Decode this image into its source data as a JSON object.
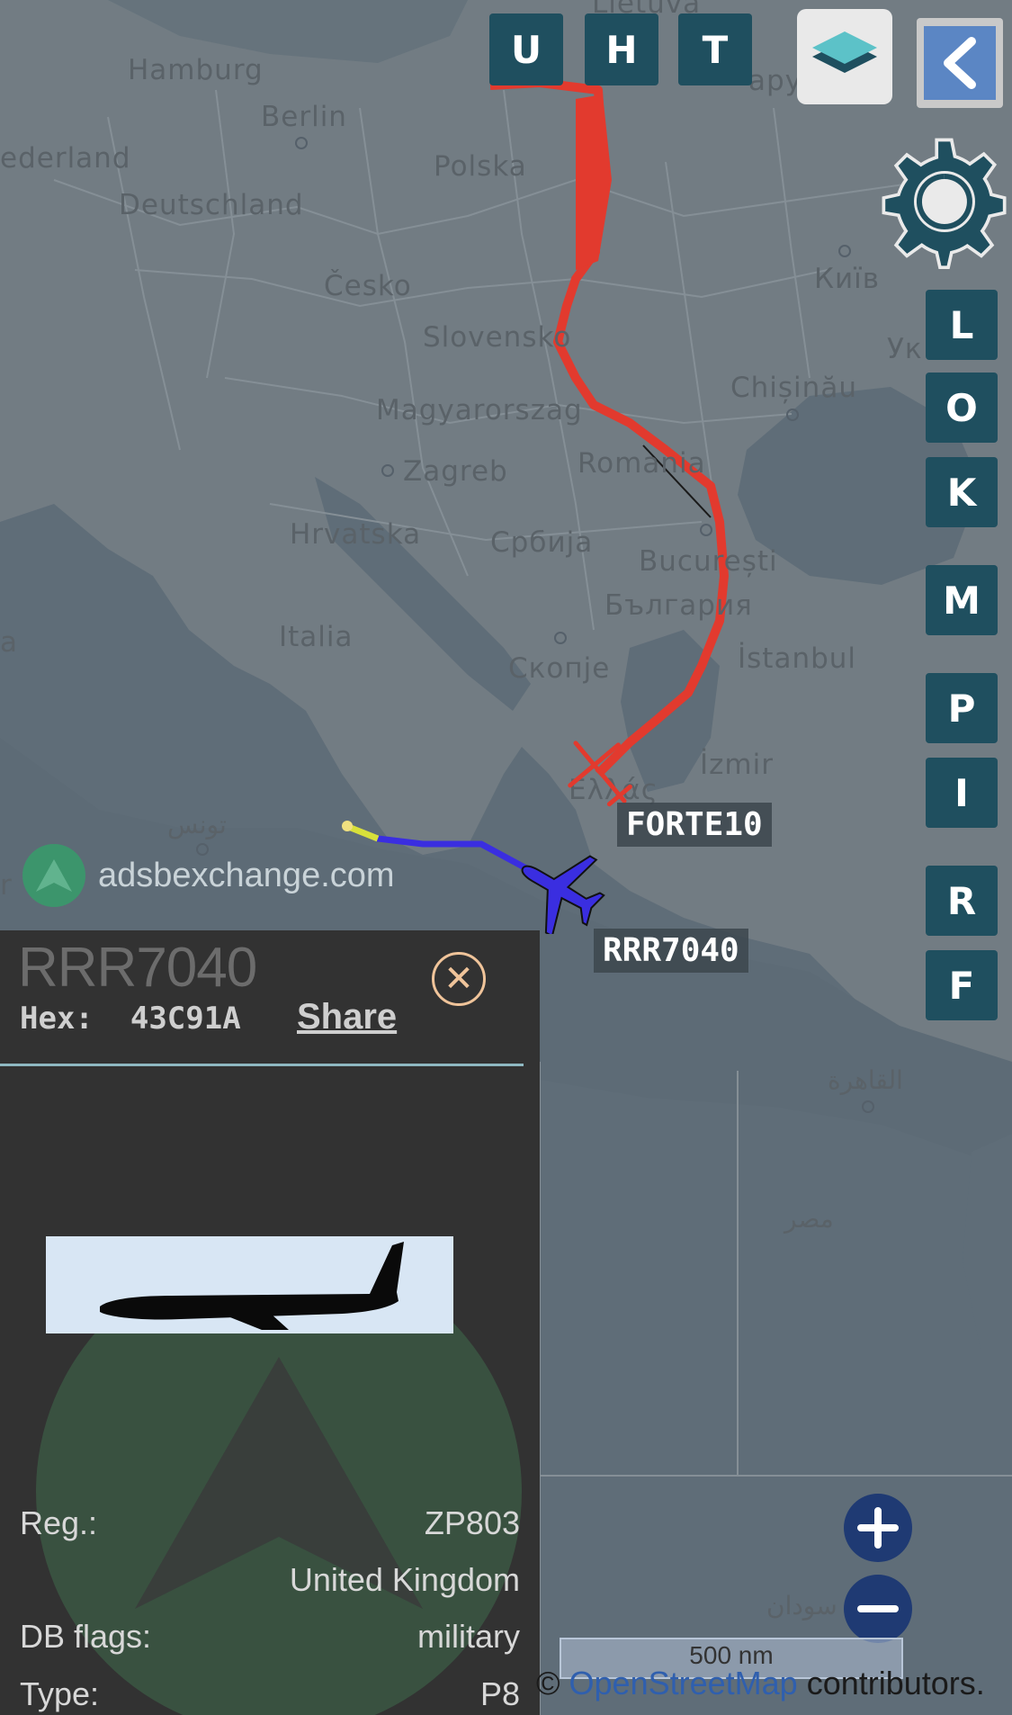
{
  "map": {
    "places": [
      {
        "id": "hamburg",
        "label": "Hamburg"
      },
      {
        "id": "berlin",
        "label": "Berlin"
      },
      {
        "id": "nederland",
        "label": "ederland"
      },
      {
        "id": "polska",
        "label": "Polska"
      },
      {
        "id": "deutschland",
        "label": "Deutschland"
      },
      {
        "id": "cesko",
        "label": "Česko"
      },
      {
        "id": "slovensko",
        "label": "Slovensko"
      },
      {
        "id": "magyarorszag",
        "label": "Magyarorszag"
      },
      {
        "id": "zagreb",
        "label": "Zagreb"
      },
      {
        "id": "romania",
        "label": "Romania"
      },
      {
        "id": "hrvatska",
        "label": "Hrvatska"
      },
      {
        "id": "srbija",
        "label": "Србија"
      },
      {
        "id": "bucuresti",
        "label": "București"
      },
      {
        "id": "bulgaria",
        "label": "България"
      },
      {
        "id": "italia",
        "label": "Italia"
      },
      {
        "id": "skopje",
        "label": "Скопје"
      },
      {
        "id": "istanbul",
        "label": "İstanbul"
      },
      {
        "id": "izmir",
        "label": "İzmir"
      },
      {
        "id": "chisinau",
        "label": "Chișinău"
      },
      {
        "id": "kyiv",
        "label": "Київ"
      },
      {
        "id": "ukr",
        "label": "Ук"
      },
      {
        "id": "lietuva",
        "label": "Lietuva"
      },
      {
        "id": "budapest",
        "label": "apy"
      },
      {
        "id": "tunis",
        "label": "تونس"
      },
      {
        "id": "cairo",
        "label": "القاهرة"
      },
      {
        "id": "misr",
        "label": "مصر"
      },
      {
        "id": "sudan",
        "label": "سودان"
      },
      {
        "id": "ellas",
        "label": "Ελλάς"
      },
      {
        "id": "left_a",
        "label": "a"
      },
      {
        "id": "left_r",
        "label": "r"
      }
    ],
    "watermark": "adsbexchange.com",
    "aircraft": [
      {
        "callsign": "FORTE10",
        "color": "#e23a2e"
      },
      {
        "callsign": "RRR7040",
        "color": "#3a2ee0"
      }
    ]
  },
  "top_buttons": [
    "U",
    "H",
    "T"
  ],
  "side_buttons": [
    "L",
    "O",
    "K",
    "M",
    "P",
    "I",
    "R",
    "F"
  ],
  "panel": {
    "title": "RRR7040",
    "hex_label": "Hex:",
    "hex_value": "43C91A",
    "share": "Share",
    "rows": [
      {
        "label": "Reg.:",
        "value": "ZP803"
      },
      {
        "label": "",
        "value": "United Kingdom"
      },
      {
        "label": "DB flags:",
        "value": "military"
      },
      {
        "label": "Type:",
        "value": "P8"
      }
    ]
  },
  "scale": "500 nm",
  "attribution": {
    "prefix": "© ",
    "link": "OpenStreetMap",
    "suffix": " contributors."
  },
  "colors": {
    "button": "#1f4f5f",
    "panel": "#323232",
    "zoom": "#1f3a73",
    "accent_close": "#f0c49a"
  }
}
